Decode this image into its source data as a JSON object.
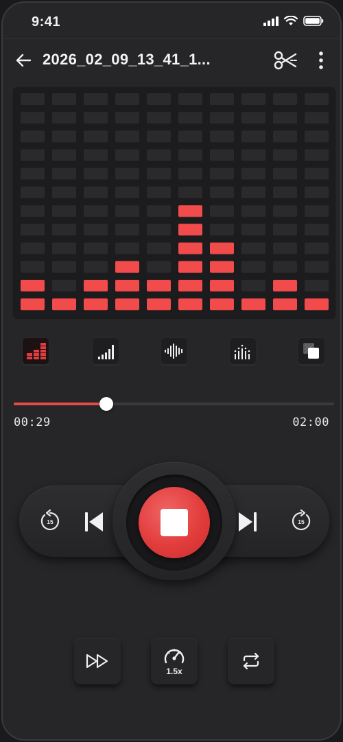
{
  "status_bar": {
    "time": "9:41"
  },
  "header": {
    "title": "2026_02_09_13_41_1..."
  },
  "visualizer": {
    "columns": 10,
    "rows": 12,
    "levels": [
      2,
      1,
      2,
      3,
      2,
      6,
      4,
      1,
      2,
      1
    ],
    "active_color": "#f24b4b",
    "inactive_color": "#2a2a2c"
  },
  "modes": {
    "items": [
      "led-bars-mode",
      "signal-bars-mode",
      "waveform-mode",
      "spectrum-mode",
      "square-mode"
    ],
    "active_index": 0
  },
  "playback": {
    "current_time": "00:29",
    "total_time": "02:00",
    "progress": 0.29,
    "skip_back_seconds": "15",
    "skip_forward_seconds": "15"
  },
  "controls": {
    "speed_label": "1.5x"
  },
  "colors": {
    "accent": "#e84a4a",
    "background": "#262628"
  }
}
